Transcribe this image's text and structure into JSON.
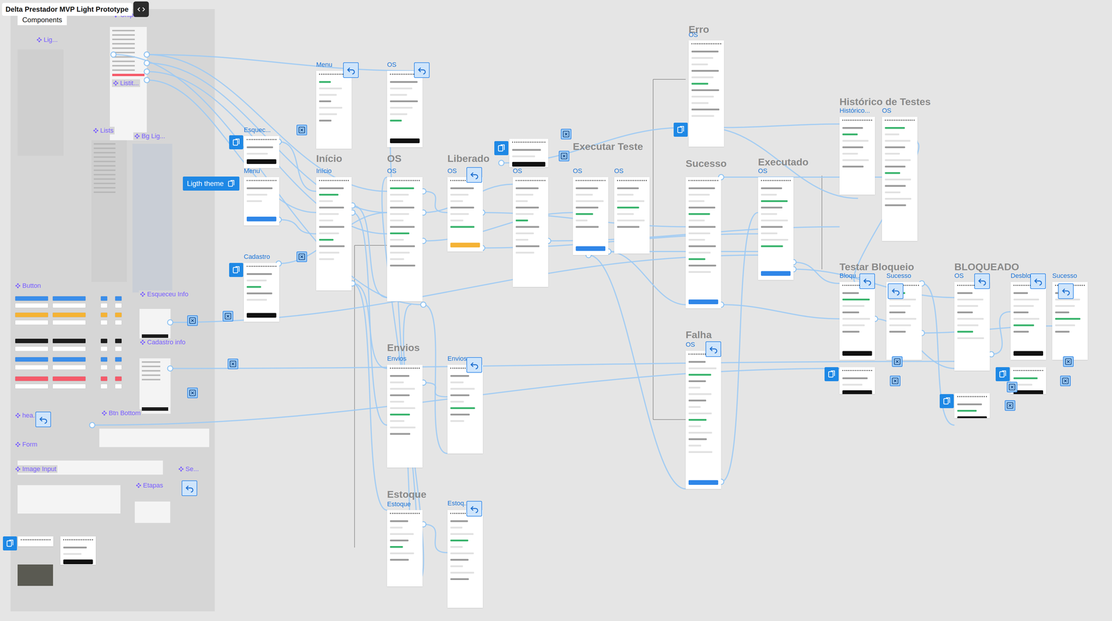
{
  "document": {
    "title": "Delta Prestador MVP Light Prototype"
  },
  "components_panel": {
    "title": "Components",
    "groups": [
      {
        "label": "Lig..."
      },
      {
        "label": "Chips"
      },
      {
        "label": "Listit..."
      },
      {
        "label": "Lists"
      },
      {
        "label": "Bg Lig..."
      },
      {
        "label": "Button"
      },
      {
        "label": "Esqueceu Info"
      },
      {
        "label": "Cadastro info"
      },
      {
        "label": "hea..."
      },
      {
        "label": "Btn Bottom"
      },
      {
        "label": "Form"
      },
      {
        "label": "Image Input"
      },
      {
        "label": "Se..."
      },
      {
        "label": "Etapas"
      }
    ]
  },
  "theme_button": {
    "label": "Ligth theme"
  },
  "sections": [
    {
      "label": "Erro"
    },
    {
      "label": "Início"
    },
    {
      "label": "OS"
    },
    {
      "label": "Liberado"
    },
    {
      "label": "Executar Teste"
    },
    {
      "label": "Sucesso"
    },
    {
      "label": "Executado"
    },
    {
      "label": "Histórico de Testes"
    },
    {
      "label": "Envios"
    },
    {
      "label": "Estoque"
    },
    {
      "label": "Falha"
    },
    {
      "label": "Testar Bloqueio"
    },
    {
      "label": "BLOQUEADO"
    }
  ],
  "frames": [
    {
      "label": "Menu"
    },
    {
      "label": "OS"
    },
    {
      "label": "OS"
    },
    {
      "label": "Esquec..."
    },
    {
      "label": "Menu"
    },
    {
      "label": "Cadastro"
    },
    {
      "label": "Início"
    },
    {
      "label": "OS"
    },
    {
      "label": "OS"
    },
    {
      "label": "OS"
    },
    {
      "label": "OS"
    },
    {
      "label": "OS"
    },
    {
      "label": "OS"
    },
    {
      "label": "Histórico..."
    },
    {
      "label": "OS"
    },
    {
      "label": "Envios"
    },
    {
      "label": "Envios"
    },
    {
      "label": "Estoque"
    },
    {
      "label": "Estoq..."
    },
    {
      "label": "OS"
    },
    {
      "label": "Bloqu..."
    },
    {
      "label": "Sucesso"
    },
    {
      "label": "OS"
    },
    {
      "label": "Desblo..."
    },
    {
      "label": "Sucesso"
    }
  ]
}
